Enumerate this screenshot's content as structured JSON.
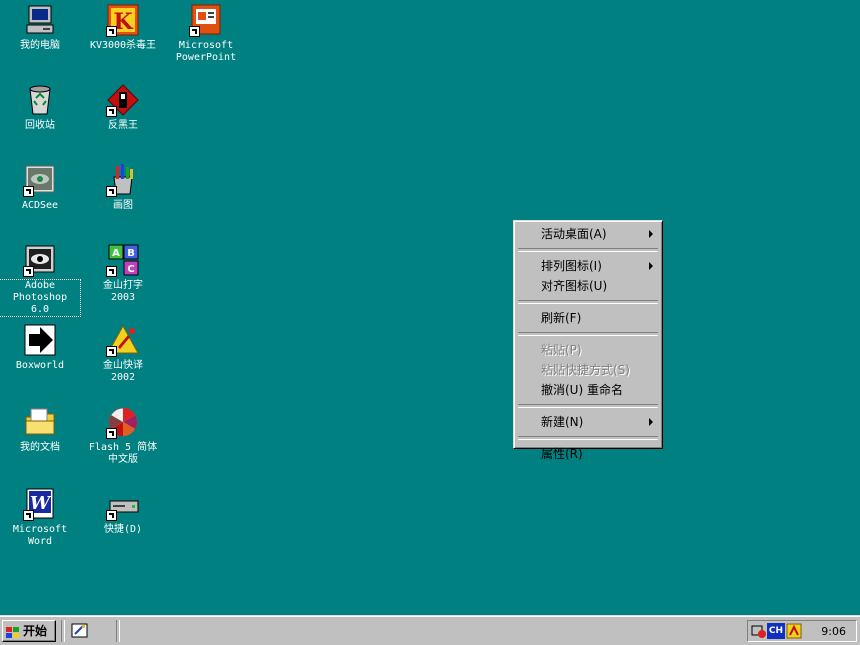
{
  "desktop": {
    "icons": [
      {
        "label": "我的电脑"
      },
      {
        "label": "KV3000杀毒王"
      },
      {
        "label": "Microsoft\nPowerPoint"
      },
      {
        "label": "回收站"
      },
      {
        "label": "反黑王"
      },
      {
        "label": "ACDSee"
      },
      {
        "label": "画图"
      },
      {
        "label": "Adobe\nPhotoshop\n6.0"
      },
      {
        "label": "金山打字\n2003"
      },
      {
        "label": "Boxworld"
      },
      {
        "label": "金山快译\n2002"
      },
      {
        "label": "我的文档"
      },
      {
        "label": "Flash 5 简体\n中文版"
      },
      {
        "label": "Microsoft\nWord"
      },
      {
        "label": "快捷(D)"
      }
    ]
  },
  "context_menu": {
    "items": [
      {
        "label": "活动桌面(A)"
      },
      {
        "label": "排列图标(I)"
      },
      {
        "label": "对齐图标(U)"
      },
      {
        "label": "刷新(F)"
      },
      {
        "label": "粘贴(P)"
      },
      {
        "label": "粘贴快捷方式(S)"
      },
      {
        "label": "撤消(U) 重命名"
      },
      {
        "label": "新建(N)"
      },
      {
        "label": "属性(R)"
      }
    ]
  },
  "taskbar": {
    "start_label": "开始",
    "tray_lang": "CH",
    "clock": "9:06"
  },
  "colors": {
    "desktop": "#008080",
    "taskbar": "#c0c0c0"
  }
}
